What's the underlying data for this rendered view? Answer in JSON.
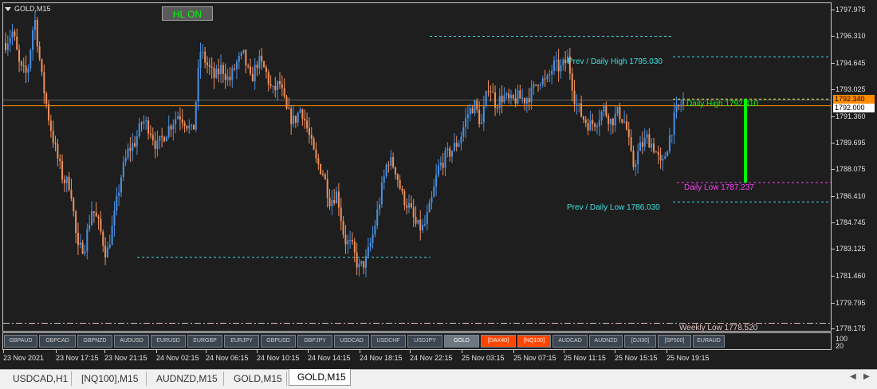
{
  "window": {
    "symbol_title": "GOLD,M15",
    "hl_button": "HL ON"
  },
  "price_axis": {
    "labels": [
      "1797.975",
      "1796.310",
      "1794.645",
      "1793.025",
      "1791.360",
      "1789.695",
      "1788.075",
      "1786.410",
      "1784.745",
      "1783.125",
      "1781.460",
      "1779.795",
      "1778.175"
    ],
    "bid_badge": "1792.340",
    "current_badge": "1792.000"
  },
  "annotations": {
    "prev_daily_high": "Prev / Daily High 1795.030",
    "prev_daily_low": "Prev / Daily Low 1786.030",
    "daily_high": "Daily High 1792.410",
    "daily_low": "Daily Low 1787.237",
    "weekly_low": "Weekly Low 1778.520"
  },
  "colors": {
    "bull": "#4a90e2",
    "bear": "#f0905a",
    "cyan_level": "#40e0e0",
    "daily_high": "#00ff00",
    "daily_low": "#ff40ff",
    "current_price": "#ff8c00",
    "hot_button": "#ff4500"
  },
  "symbol_buttons": [
    {
      "label": "GBPAUD",
      "state": "normal"
    },
    {
      "label": "GBPCAD",
      "state": "normal"
    },
    {
      "label": "GBPNZD",
      "state": "normal"
    },
    {
      "label": "AUDUSD",
      "state": "normal"
    },
    {
      "label": "EURUSD",
      "state": "normal"
    },
    {
      "label": "EURGBP",
      "state": "normal"
    },
    {
      "label": "EURJPY",
      "state": "normal"
    },
    {
      "label": "GBPUSD",
      "state": "normal"
    },
    {
      "label": "GBPJPY",
      "state": "normal"
    },
    {
      "label": "USDCAD",
      "state": "normal"
    },
    {
      "label": "USDCHF",
      "state": "normal"
    },
    {
      "label": "USDJPY",
      "state": "normal"
    },
    {
      "label": "GOLD",
      "state": "active"
    },
    {
      "label": "[DAX40]",
      "state": "hot"
    },
    {
      "label": "[NQ100]",
      "state": "hot"
    },
    {
      "label": "AUDCAD",
      "state": "normal"
    },
    {
      "label": "AUDNZD",
      "state": "normal"
    },
    {
      "label": "[DJI30]",
      "state": "normal"
    },
    {
      "label": "[SP500]",
      "state": "normal"
    },
    {
      "label": "EURAUD",
      "state": "normal"
    }
  ],
  "subwindow_scale": [
    "100",
    "20"
  ],
  "time_axis": [
    "23 Nov 2021",
    "23 Nov 17:15",
    "23 Nov 21:15",
    "24 Nov 02:15",
    "24 Nov 06:15",
    "24 Nov 10:15",
    "24 Nov 14:15",
    "24 Nov 18:15",
    "24 Nov 22:15",
    "25 Nov 03:15",
    "25 Nov 07:15",
    "25 Nov 11:15",
    "25 Nov 15:15",
    "25 Nov 19:15"
  ],
  "tabs": [
    {
      "label": "USDCAD,H1",
      "active": false
    },
    {
      "label": "[NQ100],M15",
      "active": false
    },
    {
      "label": "AUDNZD,M15",
      "active": false
    },
    {
      "label": "GOLD,M15",
      "active": false
    },
    {
      "label": "GOLD,M15",
      "active": true
    }
  ],
  "tab_scroll": {
    "left": "◀",
    "right": "▶"
  },
  "chart_data": {
    "type": "candlestick",
    "symbol": "GOLD",
    "timeframe": "M15",
    "ylim": [
      1778.0,
      1798.4
    ],
    "levels": {
      "prev_daily_high": 1795.03,
      "prev_daily_low": 1786.03,
      "daily_high": 1792.41,
      "daily_low": 1787.237,
      "weekly_low": 1778.52,
      "current_price": 1792.0,
      "bid": 1792.34
    },
    "close_path": [
      1795.9,
      1796.6,
      1794.3,
      1793.9,
      1797.6,
      1793.8,
      1791.2,
      1789.1,
      1787.4,
      1787.1,
      1783.0,
      1783.4,
      1785.7,
      1784.5,
      1782.7,
      1784.9,
      1787.6,
      1789.2,
      1789.8,
      1791.1,
      1790.6,
      1789.4,
      1790.2,
      1790.9,
      1791.5,
      1791.0,
      1790.2,
      1795.4,
      1794.5,
      1793.7,
      1794.4,
      1793.5,
      1794.6,
      1795.1,
      1793.5,
      1794.8,
      1794.2,
      1792.8,
      1793.4,
      1791.6,
      1791.0,
      1791.9,
      1790.3,
      1788.6,
      1787.9,
      1786.1,
      1786.6,
      1783.7,
      1783.3,
      1781.9,
      1782.4,
      1784.1,
      1786.4,
      1788.7,
      1788.2,
      1786.4,
      1785.7,
      1784.5,
      1784.4,
      1785.9,
      1788.1,
      1788.8,
      1789.3,
      1789.9,
      1791.4,
      1792.1,
      1790.8,
      1793.4,
      1792.1,
      1792.6,
      1792.2,
      1792.5,
      1792.4,
      1792.8,
      1793.7,
      1793.4,
      1794.5,
      1794.3,
      1794.9,
      1792.3,
      1791.3,
      1790.8,
      1791.1,
      1791.8,
      1791.0,
      1791.6,
      1790.9,
      1788.2,
      1789.4,
      1790.0,
      1789.4,
      1788.1,
      1789.9,
      1791.6,
      1792.3
    ],
    "close_path_span": [
      "23 Nov 2021",
      "25 Nov 19:15"
    ]
  }
}
